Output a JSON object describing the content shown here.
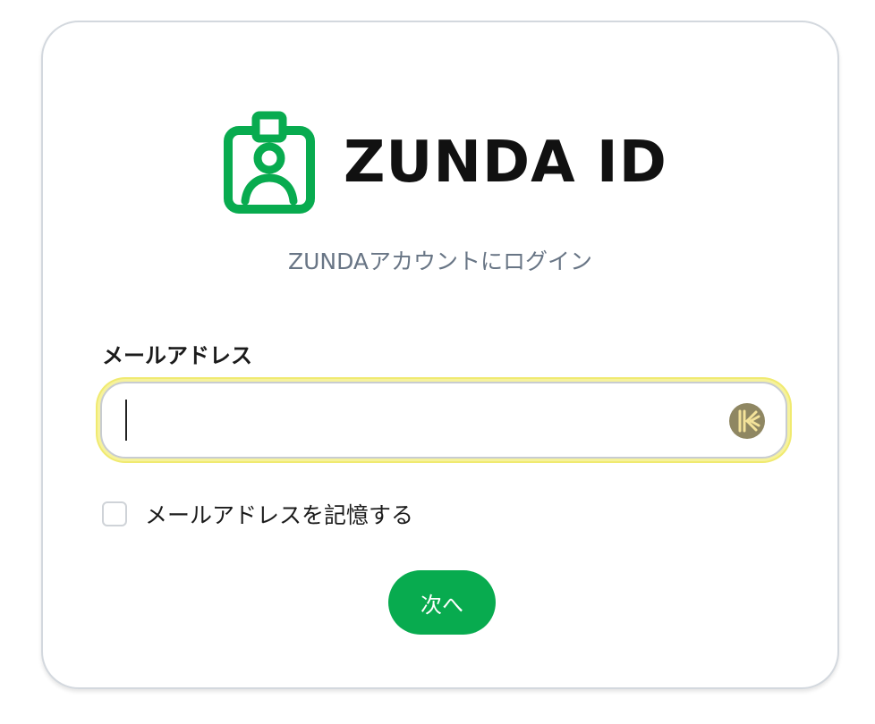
{
  "brand": {
    "name": "ZUNDA ID",
    "logo_icon": "id-badge-person-icon",
    "accent_color": "#08ab4f"
  },
  "subtitle": "ZUNDAアカウントにログイン",
  "email": {
    "label": "メールアドレス",
    "value": "",
    "password_manager_icon": "keeper-icon"
  },
  "remember": {
    "label": "メールアドレスを記憶する",
    "checked": false
  },
  "next_button": {
    "label": "次へ"
  }
}
